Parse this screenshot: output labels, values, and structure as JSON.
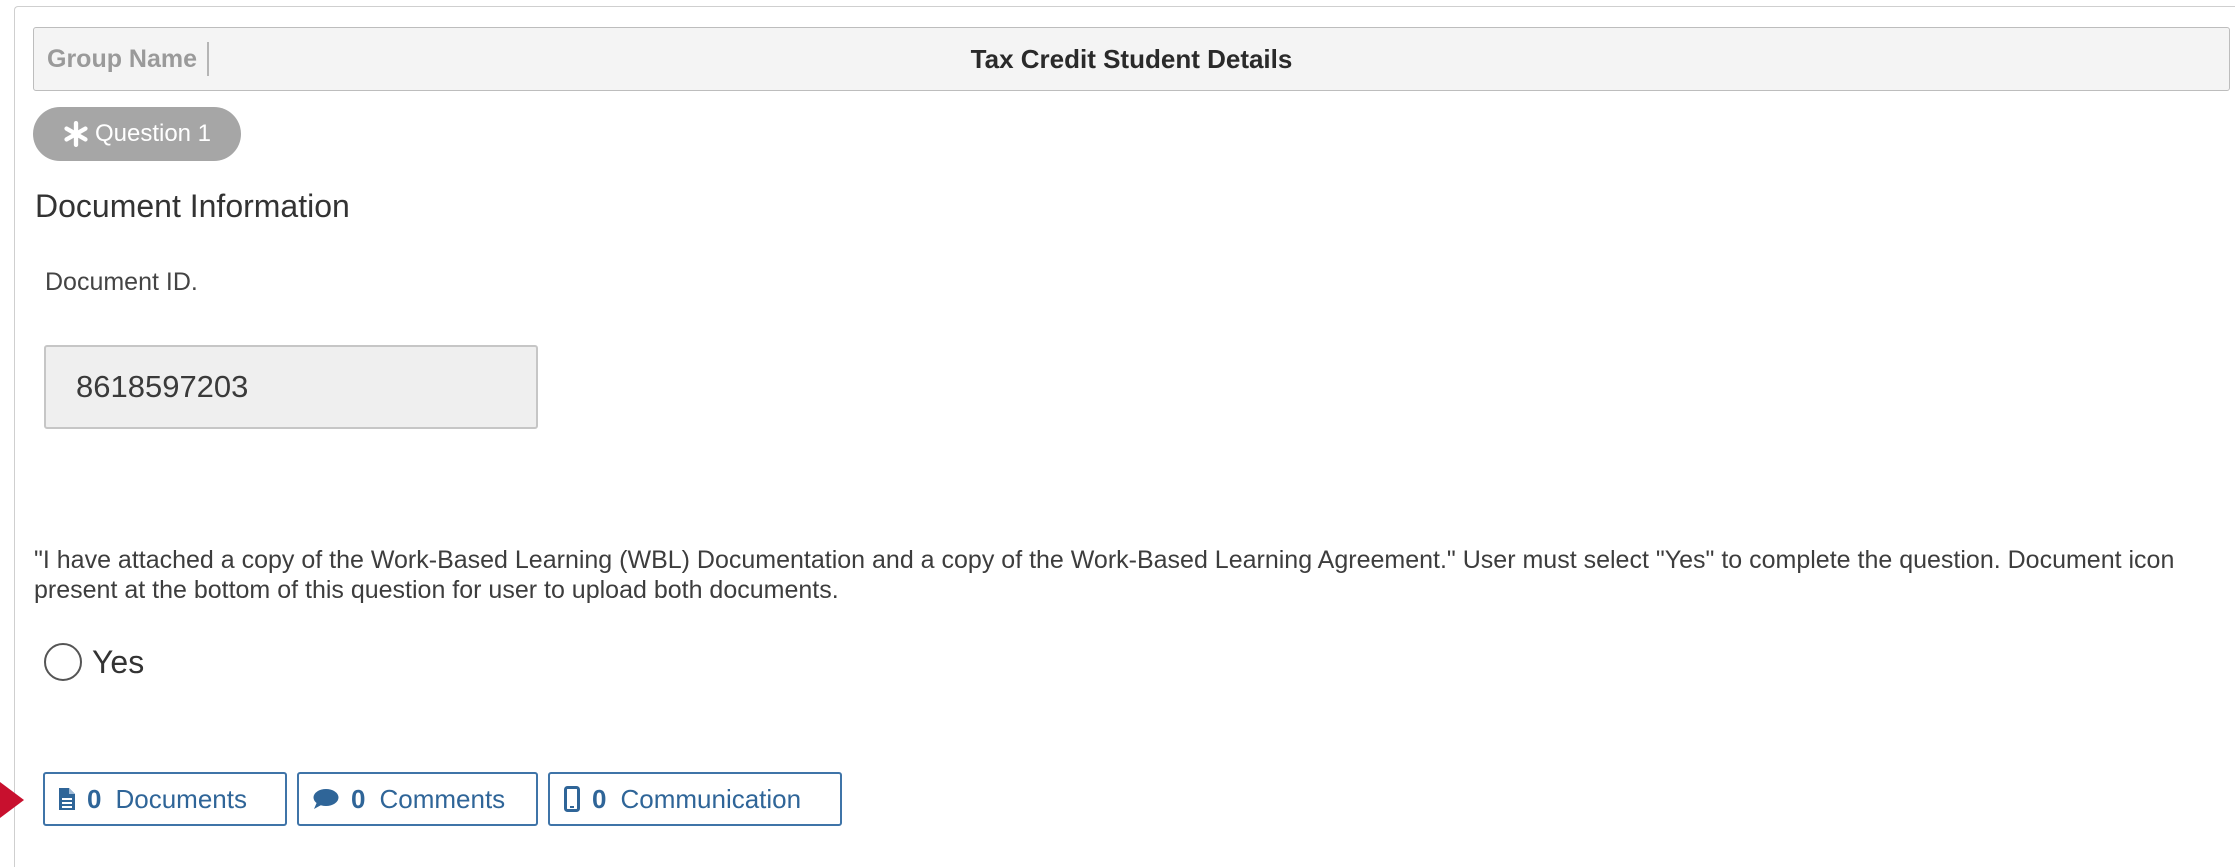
{
  "group": {
    "label": "Group Name",
    "title": "Tax Credit Student Details"
  },
  "question_badge": {
    "label": "Question 1",
    "icon": "asterisk-icon"
  },
  "section": {
    "title": "Document Information"
  },
  "document_id": {
    "label": "Document ID.",
    "value": "8618597203"
  },
  "question": {
    "text": "\"I have attached a copy of the Work-Based Learning (WBL) Documentation and a copy of the Work-Based Learning Agreement.\" User must select \"Yes\" to complete the question. Document icon present at the bottom of this question for user to upload both documents.",
    "options": [
      {
        "label": "Yes",
        "selected": false
      }
    ]
  },
  "actions": {
    "documents": {
      "count": "0",
      "label": "Documents",
      "icon": "file-icon"
    },
    "comments": {
      "count": "0",
      "label": "Comments",
      "icon": "comment-icon"
    },
    "communication": {
      "count": "0",
      "label": "Communication",
      "icon": "mobile-icon"
    }
  },
  "colors": {
    "accent": "#2f6598",
    "pill_background": "#a6a6a6",
    "pointer_arrow": "#c8102e"
  }
}
